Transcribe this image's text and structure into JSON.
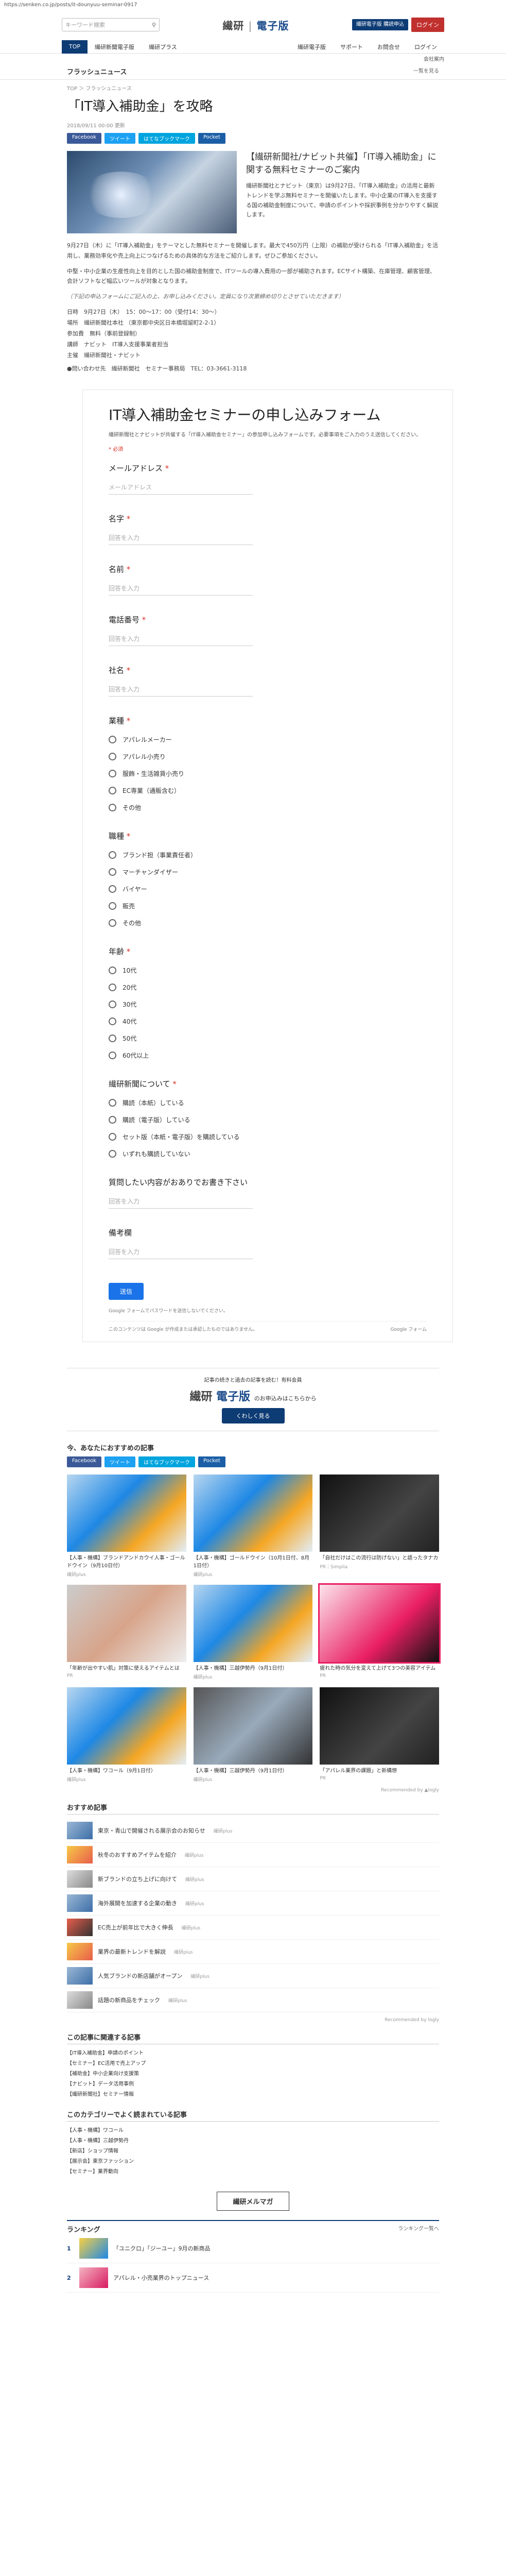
{
  "url": "https://senken.co.jp/posts/it-dounyuu-seminar-0917",
  "header": {
    "search_placeholder": "キーワード検索",
    "logo_left": "繊研",
    "logo_right": "電子版",
    "subscribe_label": "繊研電子版 購読申込",
    "login_label": "ログイン"
  },
  "nav": {
    "items": [
      "TOP",
      "繊研新聞電子版",
      "繊研プラス",
      "",
      "",
      "",
      "",
      "",
      "",
      "",
      "",
      ""
    ],
    "items_display": [
      "TOP",
      "繊研新聞電子版",
      "繊研プラス"
    ],
    "right_items": [
      "繊研電子版",
      "サポート",
      "お問合せ",
      "ログイン"
    ],
    "sub": "会社案内"
  },
  "section": {
    "title": "フラッシュニュース",
    "more": "一覧を見る"
  },
  "article": {
    "breadcrumb": "TOP ＞ フラッシュニュース",
    "title": "「IT導入補助金」を攻略",
    "meta": "2018/09/11 00:00 更新",
    "share": [
      "Facebook",
      "ツイート",
      "はてなブックマーク",
      "Pocket"
    ],
    "hero_heading": "【繊研新聞社/ナビット共催】「IT導入補助金」に関する無料セミナーのご案内",
    "hero_body": "繊研新聞社とナビット（東京）は9月27日、「IT導入補助金」の活用と最新トレンドを学ぶ無料セミナーを開催いたします。中小企業のIT導入を支援する国の補助金制度について、申請のポイントや採択事例を分かりやすく解説します。",
    "para1": "9月27日（木）に「IT導入補助金」をテーマとした無料セミナーを開催します。最大で450万円（上限）の補助が受けられる「IT導入補助金」を活用し、業務効率化や売上向上につなげるための具体的な方法をご紹介します。ぜひご参加ください。",
    "para2": "中堅・中小企業の生産性向上を目的とした国の補助金制度で、ITツールの導入費用の一部が補助されます。ECサイト構築、在庫管理、顧客管理、会計ソフトなど幅広いツールが対象となります。",
    "para3": "（下記の申込フォームにご記入の上、お申し込みください。定員になり次第締め切りとさせていただきます）",
    "info": [
      "日時　9月27日（木）　15：00～17：00（受付14：30～）",
      "場所　繊研新聞社本社 （東京都中央区日本橋堀留町2-2-1）",
      "参加費　無料（事前登録制）",
      "講師　ナビット　IT導入支援事業者担当",
      "主催　繊研新聞社・ナビット"
    ],
    "contact": "●問い合わせ先　繊研新聞社　セミナー事務局　TEL：03-3661-3118"
  },
  "form": {
    "title": "IT導入補助金セミナーの申し込みフォーム",
    "description": "繊研新聞社とナビットが共催する「IT導入補助金セミナー」の参加申し込みフォームです。必要事項をご入力のうえ送信してください。",
    "required_note": "* 必須",
    "answer_placeholder": "回答を入力",
    "questions": [
      {
        "label": "メールアドレス",
        "required": true,
        "type": "text",
        "placeholder": "メールアドレス"
      },
      {
        "label": "名字",
        "required": true,
        "type": "text"
      },
      {
        "label": "名前",
        "required": true,
        "type": "text"
      },
      {
        "label": "電話番号",
        "required": true,
        "type": "text"
      },
      {
        "label": "社名",
        "required": true,
        "type": "text"
      },
      {
        "label": "業種",
        "required": true,
        "type": "radio",
        "options": [
          "アパレルメーカー",
          "アパレル小売り",
          "服飾・生活雑貨小売り",
          "EC専業（通販含む）",
          "その他"
        ]
      },
      {
        "label": "職種",
        "required": true,
        "type": "radio",
        "options": [
          "ブランド担（事業責任者）",
          "マーチャンダイザー",
          "バイヤー",
          "販売",
          "その他"
        ]
      },
      {
        "label": "年齢",
        "required": true,
        "type": "radio",
        "options": [
          "10代",
          "20代",
          "30代",
          "40代",
          "50代",
          "60代以上"
        ]
      },
      {
        "label": "繊研新聞について",
        "required": true,
        "type": "radio",
        "options": [
          "購読（本紙）している",
          "購読（電子版）している",
          "セット版（本紙・電子版）を購読している",
          "いずれも購読していない"
        ]
      },
      {
        "label": "質問したい内容がおありでお書き下さい",
        "required": false,
        "type": "text"
      },
      {
        "label": "備考欄",
        "required": false,
        "type": "text"
      }
    ],
    "submit_label": "送信",
    "note": "Google フォームでパスワードを送信しないでください。",
    "footer": "このコンテンツは Google が作成または承認したものではありません。",
    "brand": "Google フォーム"
  },
  "promo": {
    "line": "記事の続きと過去の記事を読む！有料会員",
    "logo_left": "繊研",
    "logo_right": "電子版",
    "line2": "のお申込みはこちらから",
    "button": "くわしく見る"
  },
  "recommend": {
    "title": "今、あなたにおすすめの記事",
    "share": [
      "Facebook",
      "ツイート",
      "はてなブックマーク",
      "Pocket"
    ],
    "cards": [
      {
        "title": "【人事・機構】ブランドアンドカウイ人事・ゴールドウイン（9月10日付）",
        "src": "繊研plus"
      },
      {
        "title": "【人事・機構】ゴールドウイン（10月1日付、8月1日付）",
        "src": "繊研plus"
      },
      {
        "title": "「自社だけはこの流行は防げない」と語ったタナカ",
        "src": "PR｜Simplia"
      },
      {
        "title": "「年齢が出やすい肌」対策に使えるアイテムとは",
        "src": "PR"
      },
      {
        "title": "【人事・機構】三越伊勢丹（9月1日付）",
        "src": "繊研plus"
      },
      {
        "title": "疲れた時の気分を変えて上げて3つの美容アイテム",
        "src": "PR"
      },
      {
        "title": "【人事・機構】ワコール（9月1日付）",
        "src": "繊研plus"
      },
      {
        "title": "【人事・機構】三越伊勢丹（9月1日付）",
        "src": "繊研plus"
      },
      {
        "title": "「アパレル業界の課題」と新構想",
        "src": "PR"
      }
    ],
    "powered": "Recommended by ▲logly"
  },
  "others": {
    "title": "おすすめ記事",
    "items": [
      {
        "text": "東京・青山で開催される展示会のお知らせ",
        "src": "繊研plus"
      },
      {
        "text": "秋冬のおすすめアイテムを紹介",
        "src": "繊研plus"
      },
      {
        "text": "新ブランドの立ち上げに向けて",
        "src": "繊研plus"
      },
      {
        "text": "海外展開を加速する企業の動き",
        "src": "繊研plus"
      },
      {
        "text": "EC売上が前年比で大きく伸長",
        "src": "繊研plus"
      },
      {
        "text": "業界の最新トレンドを解説",
        "src": "繊研plus"
      },
      {
        "text": "人気ブランドの新店舗がオープン",
        "src": "繊研plus"
      },
      {
        "text": "話題の新商品をチェック",
        "src": "繊研plus"
      }
    ],
    "powered": "Recommended by logly"
  },
  "related": {
    "title": "この記事に関連する記事",
    "items": [
      "【IT導入補助金】申請のポイント",
      "【セミナー】EC活用で売上アップ",
      "【補助金】中小企業向け支援策",
      "【ナビット】データ活用事例",
      "【繊研新聞社】セミナー情報"
    ]
  },
  "category": {
    "title": "このカテゴリーでよく読まれている記事",
    "items": [
      "【人事・機構】ワコール",
      "【人事・機構】三越伊勢丹",
      "【新店】ショップ情報",
      "【展示会】東京ファッション",
      "【セミナー】業界動向"
    ]
  },
  "mail": "繊研メルマガ",
  "ranking": {
    "title": "ランキング",
    "more": "ランキング一覧へ",
    "items": [
      "「ユニクロ」「ジーユー」9月の新商品",
      "アパレル・小売業界のトップニュース"
    ]
  }
}
